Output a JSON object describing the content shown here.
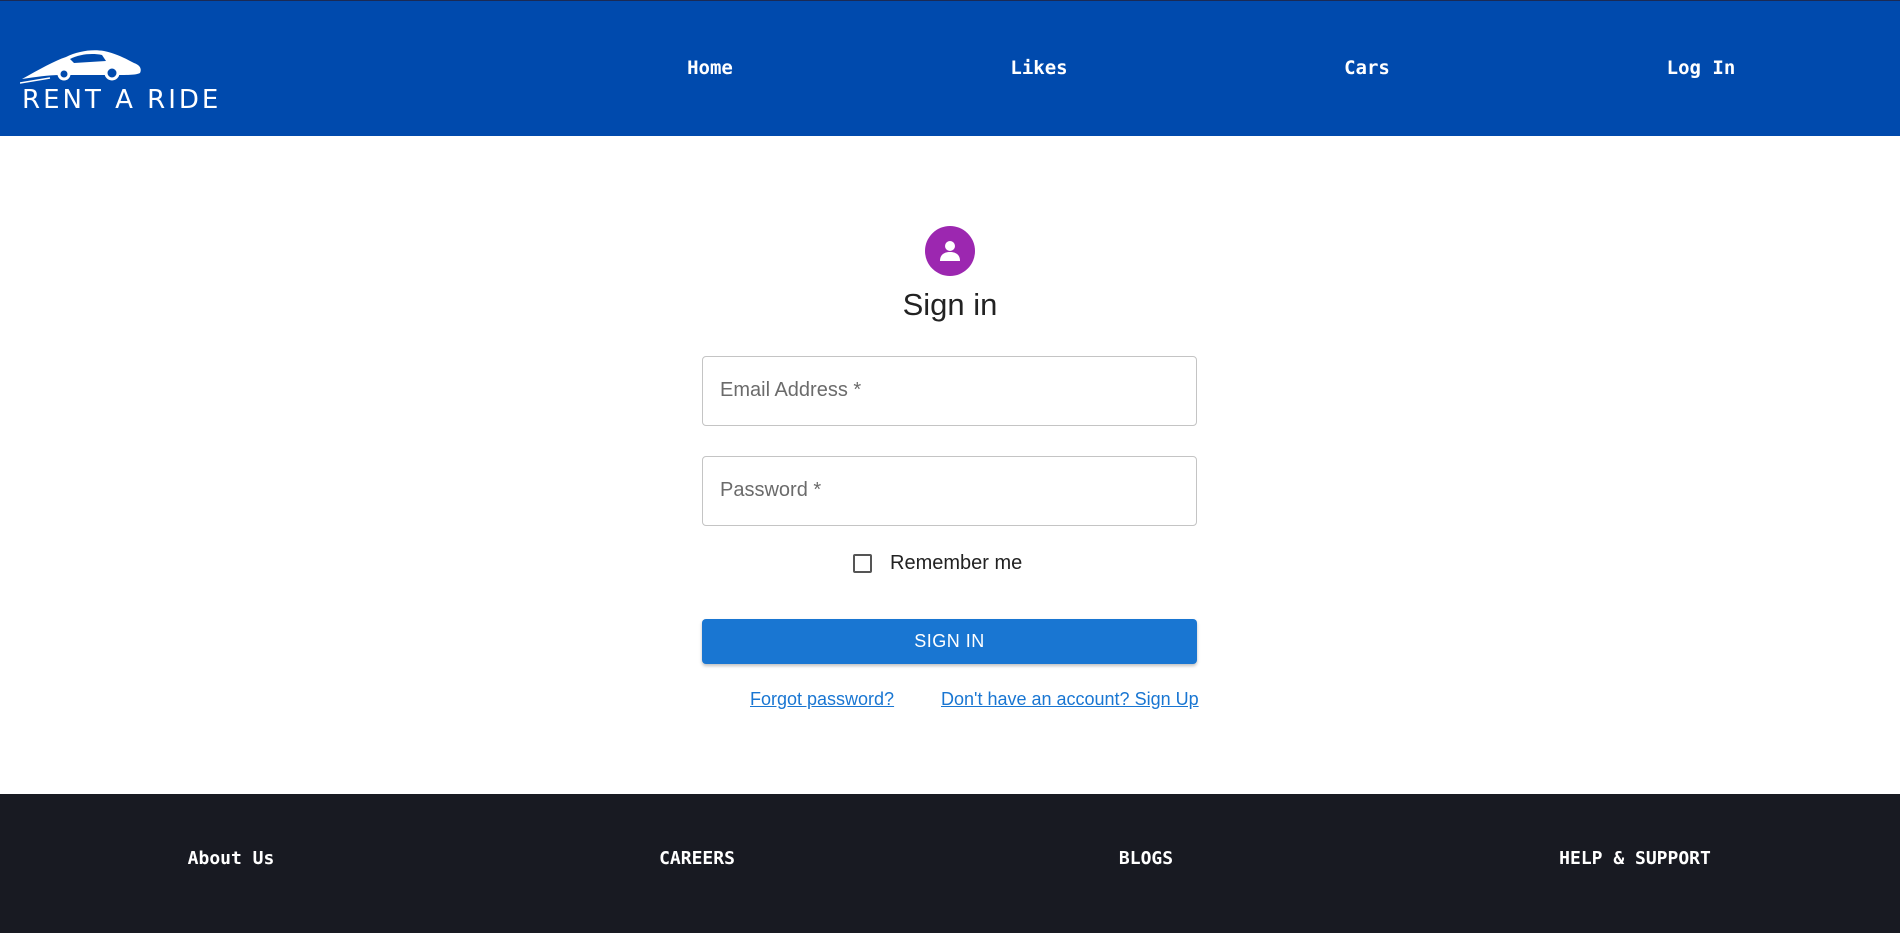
{
  "header": {
    "logo_text": "RENT A RIDE",
    "logo_icon": "car-icon",
    "nav": {
      "home": "Home",
      "likes": "Likes",
      "cars": "Cars",
      "login": "Log In"
    }
  },
  "signin": {
    "avatar_icon": "person-icon",
    "title": "Sign in",
    "email_label": "Email Address *",
    "password_label": "Password *",
    "remember_label": "Remember me",
    "remember_checked": false,
    "button_label": "SIGN IN",
    "forgot_link": "Forgot password?",
    "signup_link": "Don't have an account? Sign Up"
  },
  "footer": {
    "about": "About Us",
    "careers": "CAREERS",
    "blogs": "BLOGS",
    "help": "HELP & SUPPORT"
  },
  "colors": {
    "header_bg": "#004aad",
    "avatar_bg": "#9c27b0",
    "primary": "#1976d2",
    "footer_bg": "#181a22"
  }
}
